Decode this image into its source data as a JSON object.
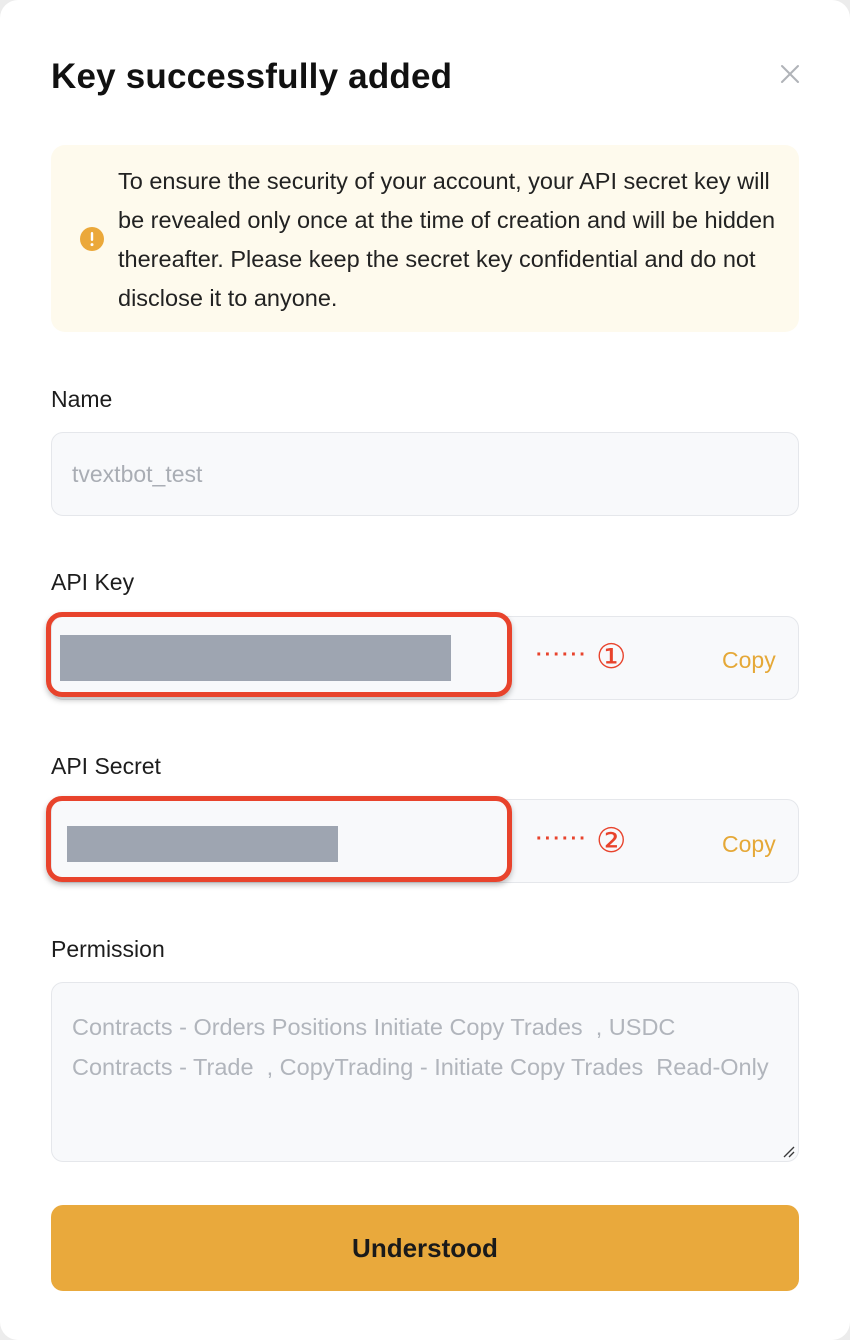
{
  "dialog": {
    "title": "Key successfully added",
    "close_icon": "close-icon"
  },
  "notice": {
    "icon": "warning-circle-icon",
    "icon_color": "#eba83a",
    "text": "To ensure the security of your account, your API secret key will be revealed only once at the time of creation and will be hidden thereafter. Please keep the secret key confidential and do not disclose it to anyone."
  },
  "name_field": {
    "label": "Name",
    "value": "tvextbot_test"
  },
  "api_key_field": {
    "label": "API Key",
    "copy_label": "Copy",
    "annotation_dots": "······",
    "annotation_marker": "①"
  },
  "api_secret_field": {
    "label": "API Secret",
    "copy_label": "Copy",
    "annotation_dots": "······",
    "annotation_marker": "②"
  },
  "permission_field": {
    "label": "Permission",
    "value": "Contracts - Orders Positions Initiate Copy Trades  , USDC Contracts - Trade  , CopyTrading - Initiate Copy Trades  Read-Only"
  },
  "primary_button": {
    "label": "Understood"
  },
  "colors": {
    "accent": "#e9a93c",
    "copy_link": "#e5a837",
    "annotation": "#e8432c",
    "notice_bg": "#fefaed"
  }
}
